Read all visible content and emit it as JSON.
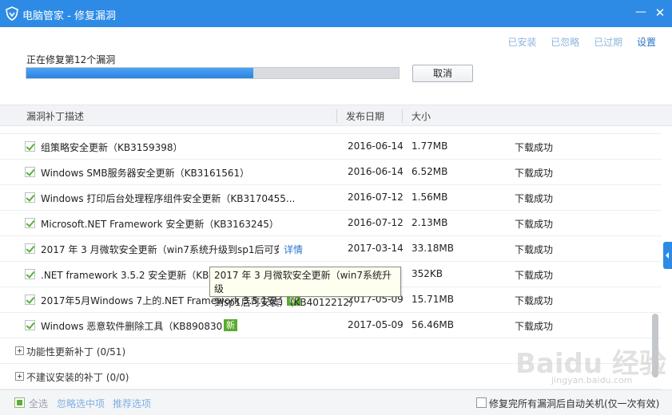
{
  "window": {
    "title": "电脑管家 - 修复漏洞",
    "minimize_icon": "minimize-icon",
    "close_icon": "close-icon"
  },
  "top_links": [
    "已安装",
    "已忽略",
    "已过期",
    "设置"
  ],
  "progress": {
    "label": "正在修复第12个漏洞",
    "fraction": 0.61,
    "cancel_label": "取消"
  },
  "table": {
    "headers": [
      "漏洞补丁描述",
      "发布日期",
      "大小"
    ],
    "rows": [
      {
        "name": "组策略安全更新（KB3159398）",
        "date": "2016-06-14",
        "size": "1.77MB",
        "status": "下载成功"
      },
      {
        "name": "Windows SMB服务器安全更新（KB3161561）",
        "date": "2016-06-14",
        "size": "6.52MB",
        "status": "下载成功"
      },
      {
        "name": "Windows 打印后台处理程序组件安全更新（KB3170455...",
        "date": "2016-07-12",
        "size": "1.56MB",
        "status": "下载成功"
      },
      {
        "name": "Microsoft.NET Framework 安全更新（KB3163245）",
        "date": "2016-07-12",
        "size": "2.13MB",
        "status": "下载成功"
      },
      {
        "name": "2017 年 3 月微软安全更新（win7系统升级到sp1后可安...",
        "date": "2017-03-14",
        "size": "33.18MB",
        "status": "下载成功",
        "detail": "详情"
      },
      {
        "name": ".NET framework 3.5.2 安全更新（KB401457",
        "date": "",
        "size": "352KB",
        "status": "下载成功"
      },
      {
        "name": "2017年5月Windows 7上的.NET Framework 3.5.1安全更新...",
        "date": "2017-05-09",
        "size": "15.71MB",
        "status": "下载成功",
        "badge": "新"
      },
      {
        "name": "Windows 恶意软件删除工具（KB89083088）",
        "date": "2017-05-09",
        "size": "56.46MB",
        "status": "下载成功",
        "badge": "新"
      }
    ],
    "groups": [
      "功能性更新补丁 (0/51)",
      "不建议安装的补丁 (0/0)"
    ]
  },
  "tooltip": {
    "line1": "2017 年 3 月微软安全更新（win7系统升级",
    "line2": "到sp1后可安装）（KB4012212）"
  },
  "footer": {
    "select_all": "全选",
    "ignore_selected": "忽略选中项",
    "recommend": "推荐选项",
    "auto_shutdown": "修复完所有漏洞后自动关机(仅一次有效)"
  },
  "colors": {
    "titlebar": "#2d8be5",
    "accent_link": "#2a74c9",
    "success_check": "#5dae3a",
    "new_badge": "#5aaa2e"
  }
}
